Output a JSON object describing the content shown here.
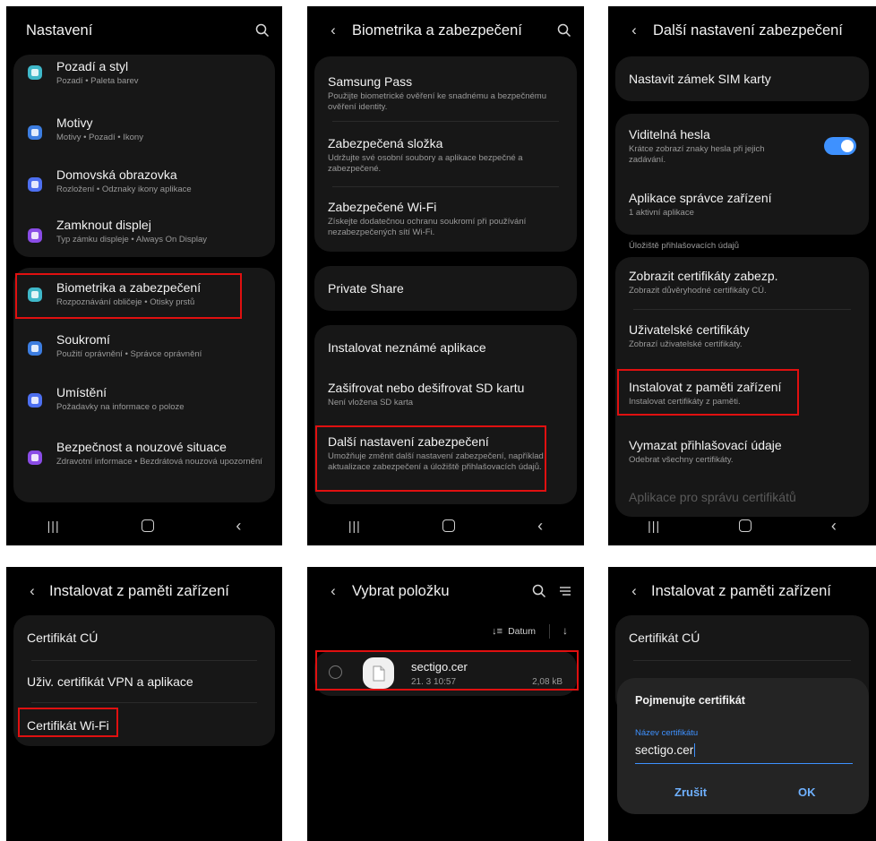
{
  "colors": {
    "accent": "#3e91ff",
    "highlight": "#e01010",
    "dialog_button": "#6fb1ff"
  },
  "panel1": {
    "title": "Nastavení",
    "items": [
      {
        "title": "Pozadí a styl",
        "subtitle": "Pozadí • Paleta barev",
        "icon": "palette-icon",
        "color": "#3fb8c9"
      },
      {
        "title": "Motivy",
        "subtitle": "Motivy • Pozadí • Ikony",
        "icon": "brush-icon",
        "color": "#3c7de0"
      },
      {
        "title": "Domovská obrazovka",
        "subtitle": "Rozložení • Odznaky ikony aplikace",
        "icon": "home-icon",
        "color": "#4d6ff0"
      },
      {
        "title": "Zamknout displej",
        "subtitle": "Typ zámku displeje • Always On Display",
        "icon": "lock-icon",
        "color": "#8a4ce6"
      },
      {
        "title": "Biometrika a zabezpečení",
        "subtitle": "Rozpoznávání obličeje • Otisky prstů",
        "icon": "shield-icon",
        "color": "#3fb8c9"
      },
      {
        "title": "Soukromí",
        "subtitle": "Použití oprávnění • Správce oprávnění",
        "icon": "privacy-icon",
        "color": "#3c7de0"
      },
      {
        "title": "Umístění",
        "subtitle": "Požadavky na informace o poloze",
        "icon": "location-icon",
        "color": "#4d6ff0"
      },
      {
        "title": "Bezpečnost a nouzové situace",
        "subtitle": "Zdravotní informace • Bezdrátová nouzová upozornění",
        "icon": "emergency-icon",
        "color": "#8a4ce6"
      }
    ]
  },
  "panel2": {
    "title": "Biometrika a zabezpečení",
    "items": [
      {
        "title": "Samsung Pass",
        "subtitle": "Použijte biometrické ověření ke snadnému a bezpečnému ověření identity."
      },
      {
        "title": "Zabezpečená složka",
        "subtitle": "Udržujte své osobní soubory a aplikace bezpečné a zabezpečené."
      },
      {
        "title": "Zabezpečené Wi-Fi",
        "subtitle": "Získejte dodatečnou ochranu soukromí při používání nezabezpečených sítí Wi-Fi."
      },
      {
        "title": "Private Share",
        "subtitle": ""
      },
      {
        "title": "Instalovat neznámé aplikace",
        "subtitle": ""
      },
      {
        "title": "Zašifrovat nebo dešifrovat SD kartu",
        "subtitle": "Není vložena SD karta"
      },
      {
        "title": "Další nastavení zabezpečení",
        "subtitle": "Umožňuje změnit další nastavení zabezpečení, například aktualizace zabezpečení a úložiště přihlašovacích údajů."
      }
    ]
  },
  "panel3": {
    "title": "Další nastavení zabezpečení",
    "sim_lock": "Nastavit zámek SIM karty",
    "visible_passwords": {
      "title": "Viditelná hesla",
      "subtitle": "Krátce zobrazí znaky hesla při jejich zadávání.",
      "on": true
    },
    "device_admin": {
      "title": "Aplikace správce zařízení",
      "subtitle": "1 aktivní aplikace"
    },
    "section_label": "Úložiště přihlašovacích údajů",
    "credential_items": [
      {
        "title": "Zobrazit certifikáty zabezp.",
        "subtitle": "Zobrazit důvěryhodné certifikáty CÚ."
      },
      {
        "title": "Uživatelské certifikáty",
        "subtitle": "Zobrazí uživatelské certifikáty."
      },
      {
        "title": "Instalovat z paměti zařízení",
        "subtitle": "Instalovat certifikáty z paměti."
      },
      {
        "title": "Vymazat přihlašovací údaje",
        "subtitle": "Odebrat všechny certifikáty."
      }
    ],
    "faded_item": "Aplikace pro správu certifikátů"
  },
  "panel4": {
    "title": "Instalovat z paměti zařízení",
    "items": [
      "Certifikát CÚ",
      "Uživ. certifikát VPN a aplikace",
      "Certifikát Wi-Fi"
    ]
  },
  "panel5": {
    "title": "Vybrat položku",
    "sort_label": "Datum",
    "file": {
      "name": "sectigo.cer",
      "date": "21. 3 10:57",
      "size": "2,08 kB"
    }
  },
  "panel6": {
    "title": "Instalovat z paměti zařízení",
    "first_item": "Certifikát CÚ",
    "dialog": {
      "title": "Pojmenujte certifikát",
      "field_label": "Název certifikátu",
      "field_value": "sectigo.cer",
      "cancel": "Zrušit",
      "ok": "OK"
    }
  }
}
